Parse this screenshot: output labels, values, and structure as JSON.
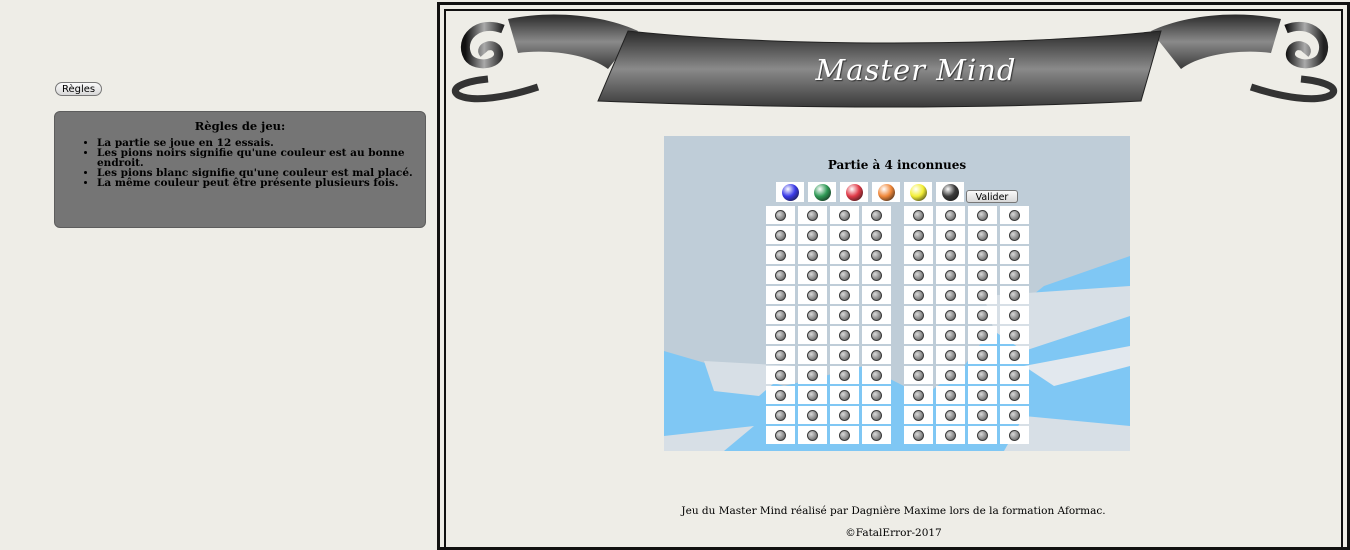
{
  "sidebar": {
    "rules_button_label": "Règles",
    "rules_title": "Règles de jeu:",
    "rules": [
      "La partie se joue en 12 essais.",
      "Les pions noirs signifie qu'une couleur est au bonne endroit.",
      "Les pions blanc signifie qu'une couleur est mal placé.",
      "La même couleur peut être présente plusieurs fois."
    ]
  },
  "header": {
    "title": "Master Mind"
  },
  "game": {
    "title": "Partie à 4 inconnues",
    "validate_label": "Valider",
    "palette": [
      {
        "name": "blue",
        "color": "#3a3ae8"
      },
      {
        "name": "green",
        "color": "#2f9a56"
      },
      {
        "name": "red",
        "color": "#e03a48"
      },
      {
        "name": "orange",
        "color": "#f0883a"
      },
      {
        "name": "yellow",
        "color": "#f3ef36"
      },
      {
        "name": "black",
        "color": "#3a3a3a"
      }
    ],
    "attempts": 12,
    "unknowns": 4,
    "feedback_pegs": 4
  },
  "footer": {
    "credit": "Jeu du Master Mind réalisé par Dagnière Maxime lors de la formation Aformac.",
    "copyright": "©FatalError-2017"
  }
}
